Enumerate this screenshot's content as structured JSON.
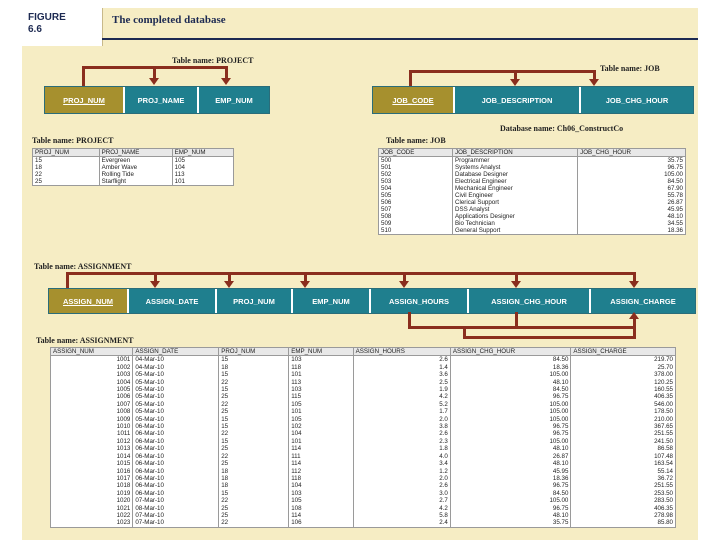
{
  "figure": {
    "label": "FIGURE\n6.6",
    "title": "The completed database"
  },
  "diagram": {
    "project_name_label": "Table name: PROJECT",
    "job_name_label": "Table name: JOB",
    "database_label": "Database name: Ch06_ConstructCo",
    "assignment_name_label": "Table name: ASSIGNMENT",
    "project_cols": [
      "PROJ_NUM",
      "PROJ_NAME",
      "EMP_NUM"
    ],
    "job_cols": [
      "JOB_CODE",
      "JOB_DESCRIPTION",
      "JOB_CHG_HOUR"
    ],
    "assignment_cols": [
      "ASSIGN_NUM",
      "ASSIGN_DATE",
      "PROJ_NUM",
      "EMP_NUM",
      "ASSIGN_HOURS",
      "ASSIGN_CHG_HOUR",
      "ASSIGN_CHARGE"
    ]
  },
  "project_table": {
    "caption": "Table name: PROJECT",
    "headers": [
      "PROJ_NUM",
      "PROJ_NAME",
      "EMP_NUM"
    ],
    "rows": [
      [
        "15",
        "Evergreen",
        "105"
      ],
      [
        "18",
        "Amber Wave",
        "104"
      ],
      [
        "22",
        "Rolling Tide",
        "113"
      ],
      [
        "25",
        "Starflight",
        "101"
      ]
    ]
  },
  "job_table": {
    "caption": "Table name: JOB",
    "headers": [
      "JOB_CODE",
      "JOB_DESCRIPTION",
      "JOB_CHG_HOUR"
    ],
    "rows": [
      [
        "500",
        "Programmer",
        "35.75"
      ],
      [
        "501",
        "Systems Analyst",
        "96.75"
      ],
      [
        "502",
        "Database Designer",
        "105.00"
      ],
      [
        "503",
        "Electrical Engineer",
        "84.50"
      ],
      [
        "504",
        "Mechanical Engineer",
        "67.90"
      ],
      [
        "505",
        "Civil Engineer",
        "55.78"
      ],
      [
        "506",
        "Clerical Support",
        "26.87"
      ],
      [
        "507",
        "DSS Analyst",
        "45.95"
      ],
      [
        "508",
        "Applications Designer",
        "48.10"
      ],
      [
        "509",
        "Bio Technician",
        "34.55"
      ],
      [
        "510",
        "General Support",
        "18.36"
      ]
    ]
  },
  "assignment_table": {
    "caption": "Table name: ASSIGNMENT",
    "headers": [
      "ASSIGN_NUM",
      "ASSIGN_DATE",
      "PROJ_NUM",
      "EMP_NUM",
      "ASSIGN_HOURS",
      "ASSIGN_CHG_HOUR",
      "ASSIGN_CHARGE"
    ],
    "rows": [
      [
        "1001",
        "04-Mar-10",
        "15",
        "103",
        "2.6",
        "84.50",
        "219.70"
      ],
      [
        "1002",
        "04-Mar-10",
        "18",
        "118",
        "1.4",
        "18.36",
        "25.70"
      ],
      [
        "1003",
        "05-Mar-10",
        "15",
        "101",
        "3.6",
        "105.00",
        "378.00"
      ],
      [
        "1004",
        "05-Mar-10",
        "22",
        "113",
        "2.5",
        "48.10",
        "120.25"
      ],
      [
        "1005",
        "05-Mar-10",
        "15",
        "103",
        "1.9",
        "84.50",
        "160.55"
      ],
      [
        "1006",
        "05-Mar-10",
        "25",
        "115",
        "4.2",
        "96.75",
        "406.35"
      ],
      [
        "1007",
        "05-Mar-10",
        "22",
        "105",
        "5.2",
        "105.00",
        "546.00"
      ],
      [
        "1008",
        "05-Mar-10",
        "25",
        "101",
        "1.7",
        "105.00",
        "178.50"
      ],
      [
        "1009",
        "05-Mar-10",
        "15",
        "105",
        "2.0",
        "105.00",
        "210.00"
      ],
      [
        "1010",
        "06-Mar-10",
        "15",
        "102",
        "3.8",
        "96.75",
        "367.65"
      ],
      [
        "1011",
        "06-Mar-10",
        "22",
        "104",
        "2.6",
        "96.75",
        "251.55"
      ],
      [
        "1012",
        "06-Mar-10",
        "15",
        "101",
        "2.3",
        "105.00",
        "241.50"
      ],
      [
        "1013",
        "06-Mar-10",
        "25",
        "114",
        "1.8",
        "48.10",
        "86.58"
      ],
      [
        "1014",
        "06-Mar-10",
        "22",
        "111",
        "4.0",
        "26.87",
        "107.48"
      ],
      [
        "1015",
        "06-Mar-10",
        "25",
        "114",
        "3.4",
        "48.10",
        "163.54"
      ],
      [
        "1016",
        "06-Mar-10",
        "18",
        "112",
        "1.2",
        "45.95",
        "55.14"
      ],
      [
        "1017",
        "06-Mar-10",
        "18",
        "118",
        "2.0",
        "18.36",
        "36.72"
      ],
      [
        "1018",
        "06-Mar-10",
        "18",
        "104",
        "2.6",
        "96.75",
        "251.55"
      ],
      [
        "1019",
        "06-Mar-10",
        "15",
        "103",
        "3.0",
        "84.50",
        "253.50"
      ],
      [
        "1020",
        "07-Mar-10",
        "22",
        "105",
        "2.7",
        "105.00",
        "283.50"
      ],
      [
        "1021",
        "08-Mar-10",
        "25",
        "108",
        "4.2",
        "96.75",
        "406.35"
      ],
      [
        "1022",
        "07-Mar-10",
        "25",
        "114",
        "5.8",
        "48.10",
        "278.98"
      ],
      [
        "1023",
        "07-Mar-10",
        "22",
        "106",
        "2.4",
        "35.75",
        "85.80"
      ]
    ]
  }
}
